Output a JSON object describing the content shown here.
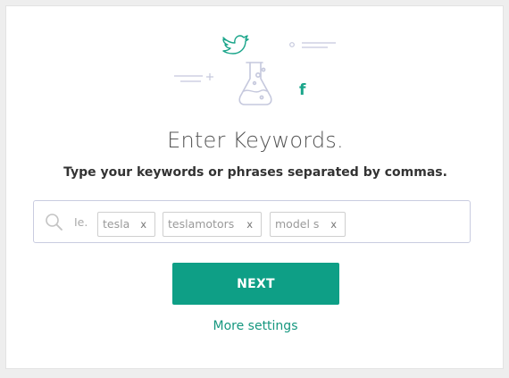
{
  "title": "Enter Keywords.",
  "subtitle": "Type your keywords or phrases separated by commas.",
  "keyword_input": {
    "prefix": "Ie.",
    "tags": [
      {
        "label": "tesla",
        "close": "x"
      },
      {
        "label": "teslamotors",
        "close": "x"
      },
      {
        "label": "model s",
        "close": "x"
      }
    ]
  },
  "next_button_label": "NEXT",
  "more_settings_label": "More settings",
  "icons": [
    "twitter-icon",
    "facebook-icon",
    "flask-icon",
    "search-icon"
  ],
  "colors": {
    "accent": "#0e9f86",
    "link": "#16977f",
    "illustration": "#c5c8dd",
    "social": "#1aa58a"
  }
}
